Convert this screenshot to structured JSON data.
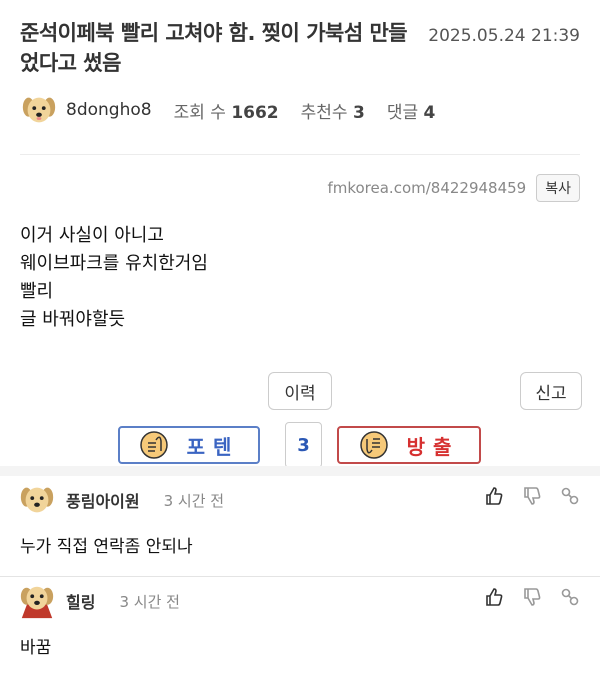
{
  "post": {
    "title": "준석이페북 빨리 고쳐야 함. 찢이 가북섬 만들었다고 썼음",
    "date": "2025.05.24 21:39",
    "author": "8dongho8",
    "views_label": "조회 수",
    "views": "1662",
    "recommend_label": "추천수",
    "recommend": "3",
    "comments_label": "댓글",
    "comments": "4",
    "url": "fmkorea.com/8422948459",
    "copy_label": "복사",
    "body": [
      "이거 사실이 아니고",
      "웨이브파크를 유치한거임",
      "빨리",
      "글 바꿔야할듯"
    ],
    "history_label": "이력",
    "report_label": "신고",
    "vote_up_label": "포텐",
    "vote_count": "3",
    "vote_down_label": "방출"
  },
  "comments": [
    {
      "author": "풍림아이원",
      "time": "3 시간 전",
      "text": "누가 직접 연락좀 안되나"
    },
    {
      "author": "힐링",
      "time": "3 시간 전",
      "text": "바꿈"
    }
  ],
  "colors": {
    "vote_up": "#3a64c2",
    "vote_down": "#d63030",
    "count": "#2b58b5"
  }
}
